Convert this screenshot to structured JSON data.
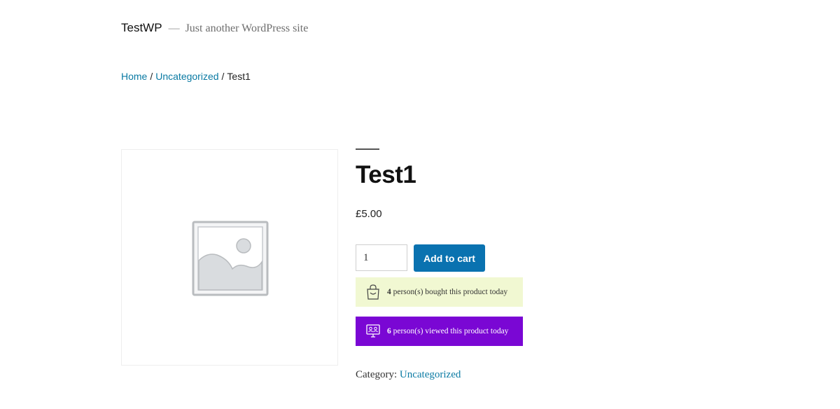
{
  "site": {
    "title": "TestWP",
    "separator": "—",
    "tagline": "Just another WordPress site"
  },
  "breadcrumb": {
    "items": [
      "Home",
      "Uncategorized",
      "Test1"
    ],
    "separator": "/"
  },
  "product": {
    "title": "Test1",
    "price": "£5.00",
    "quantity": "1",
    "add_to_cart_label": "Add to cart",
    "image_icon": "image-placeholder-icon"
  },
  "notices": {
    "bought": {
      "count": "4",
      "text": "person(s) bought this product today",
      "icon": "shopping-bag-icon",
      "background": "#f1f8d2"
    },
    "viewed": {
      "count": "6",
      "text": "person(s) viewed this product today",
      "icon": "monitor-users-icon",
      "background": "#7a07d4"
    }
  },
  "meta": {
    "category_label": "Category:",
    "category_value": "Uncategorized"
  },
  "colors": {
    "link": "#0a7aa3",
    "button": "#0a72b0"
  }
}
